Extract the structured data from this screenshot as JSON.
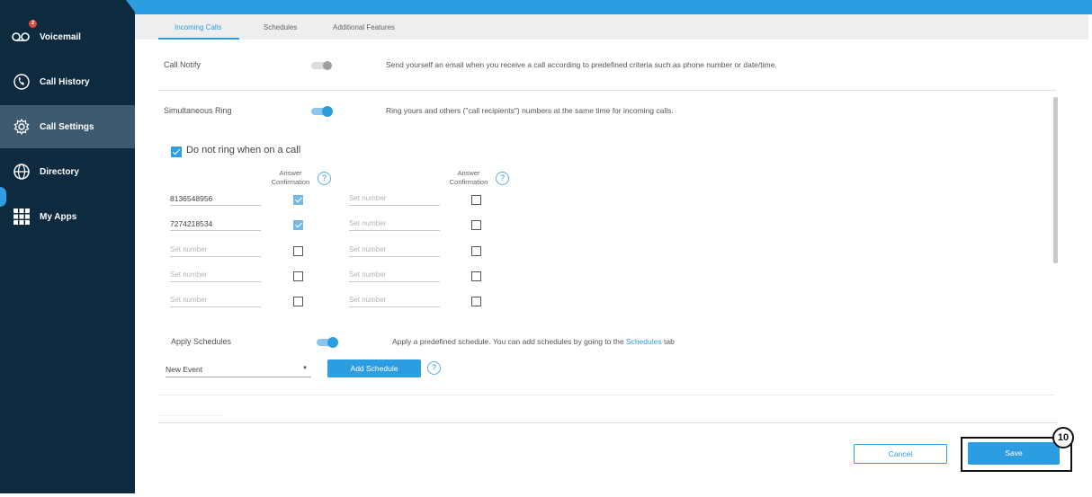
{
  "sidebar": {
    "items": [
      {
        "label": "Voicemail",
        "icon": "voicemail-icon",
        "badge": "2"
      },
      {
        "label": "Call History",
        "icon": "call-history-icon"
      },
      {
        "label": "Call Settings",
        "icon": "gear-icon",
        "active": true
      },
      {
        "label": "Directory",
        "icon": "globe-icon"
      },
      {
        "label": "My Apps",
        "icon": "apps-grid-icon"
      }
    ]
  },
  "tabs": [
    {
      "label": "Incoming Calls",
      "active": true
    },
    {
      "label": "Schedules"
    },
    {
      "label": "Additional Features"
    }
  ],
  "call_notify": {
    "label": "Call Notify",
    "enabled": false,
    "description": "Send yourself an email when you receive a call according to predefined criteria such as phone number or date/time."
  },
  "simultaneous_ring": {
    "label": "Simultaneous Ring",
    "enabled": true,
    "description": "Ring yours and others (\"call recipients\") numbers at the same time for incoming calls.",
    "do_not_ring_label": "Do not ring when on a call",
    "do_not_ring_checked": true,
    "answer_confirmation_header_line1": "Answer",
    "answer_confirmation_header_line2": "Confirmation",
    "help_glyph": "?",
    "number_placeholder": "Set number",
    "left_numbers": [
      {
        "value": "8136548956",
        "confirm": true
      },
      {
        "value": "7274218534",
        "confirm": true
      },
      {
        "value": "",
        "confirm": false
      },
      {
        "value": "",
        "confirm": false
      },
      {
        "value": "",
        "confirm": false
      }
    ],
    "right_numbers": [
      {
        "value": "",
        "confirm": false
      },
      {
        "value": "",
        "confirm": false
      },
      {
        "value": "",
        "confirm": false
      },
      {
        "value": "",
        "confirm": false
      },
      {
        "value": "",
        "confirm": false
      }
    ]
  },
  "apply_schedules": {
    "label": "Apply Schedules",
    "enabled": true,
    "description_prefix": "Apply a predefined schedule. You can add schedules by going to the ",
    "link_text": "Schedules",
    "description_suffix": " tab",
    "dropdown_value": "New Event",
    "dropdown_arrow": "▼",
    "add_button_label": "Add Schedule"
  },
  "footer": {
    "cancel_label": "Cancel",
    "save_label": "Save",
    "callout_number": "10"
  },
  "colors": {
    "accent": "#2d9de2",
    "sidebar_bg": "#0d2a3e",
    "sidebar_active": "#3e5a6e"
  }
}
